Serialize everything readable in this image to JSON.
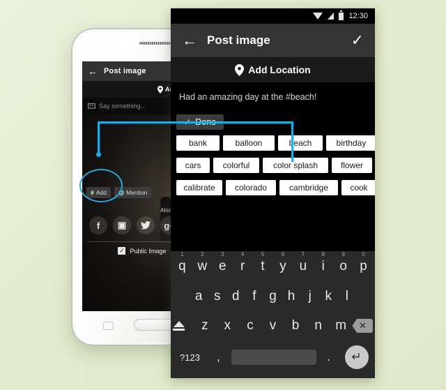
{
  "background": {
    "color": "#e3ecd0"
  },
  "accent": {
    "annotation_color": "#29a8dd"
  },
  "phone_mockup": {
    "appbar": {
      "back_icon": "arrow-left-icon",
      "title": "Post image"
    },
    "location_bar": {
      "pin_icon": "location-pin-icon",
      "label": "Add Locati"
    },
    "composer": {
      "icon": "comment-icon",
      "placeholder": "Say something..."
    },
    "tag_buttons": [
      {
        "icon": "#",
        "label": "Add"
      },
      {
        "icon": "@",
        "label": "Mention"
      }
    ],
    "also_share_on": "Also share on",
    "social_icons": [
      {
        "name": "facebook-icon",
        "glyph": "f"
      },
      {
        "name": "instagram-icon",
        "glyph": "▣"
      },
      {
        "name": "twitter-icon",
        "glyph": "🐦"
      },
      {
        "name": "google-plus-icon",
        "glyph": "g+"
      }
    ],
    "public_image": {
      "label": "Public Image",
      "checked": true,
      "check_glyph": "✓"
    }
  },
  "device": {
    "statusbar": {
      "wifi_icon": "wifi-icon",
      "signal_icon": "signal-icon",
      "battery_icon": "battery-icon",
      "time": "12:30"
    },
    "appbar": {
      "back_icon": "arrow-left-icon",
      "title": "Post image",
      "confirm_icon": "check-icon"
    },
    "location_bar": {
      "pin_icon": "location-pin-icon",
      "label": "Add Location"
    },
    "caption": "Had an amazing day at the #beach!",
    "done_button": {
      "check_glyph": "✓",
      "label": "Done"
    },
    "suggestion_rows": [
      [
        "bank",
        "balloon",
        "beach",
        "birthday"
      ],
      [
        "cars",
        "colorful",
        "color splash",
        "flower"
      ],
      [
        "calibrate",
        "colorado",
        "cambridge",
        "cook"
      ]
    ],
    "keyboard": {
      "row1": [
        {
          "k": "q",
          "n": "1"
        },
        {
          "k": "w",
          "n": "2"
        },
        {
          "k": "e",
          "n": "3"
        },
        {
          "k": "r",
          "n": "4"
        },
        {
          "k": "t",
          "n": "5"
        },
        {
          "k": "y",
          "n": "6"
        },
        {
          "k": "u",
          "n": "7"
        },
        {
          "k": "i",
          "n": "8"
        },
        {
          "k": "o",
          "n": "9"
        },
        {
          "k": "p",
          "n": "0"
        }
      ],
      "row2": [
        "a",
        "s",
        "d",
        "f",
        "g",
        "h",
        "j",
        "k",
        "l"
      ],
      "row3": [
        "z",
        "x",
        "c",
        "v",
        "b",
        "n",
        "m"
      ],
      "shift_icon": "shift-icon",
      "backspace_icon": "backspace-icon",
      "symbols_key": "?123",
      "comma_key": ",",
      "space_key": "",
      "period_key": ".",
      "enter_icon": "enter-icon",
      "enter_glyph": "↵"
    }
  }
}
